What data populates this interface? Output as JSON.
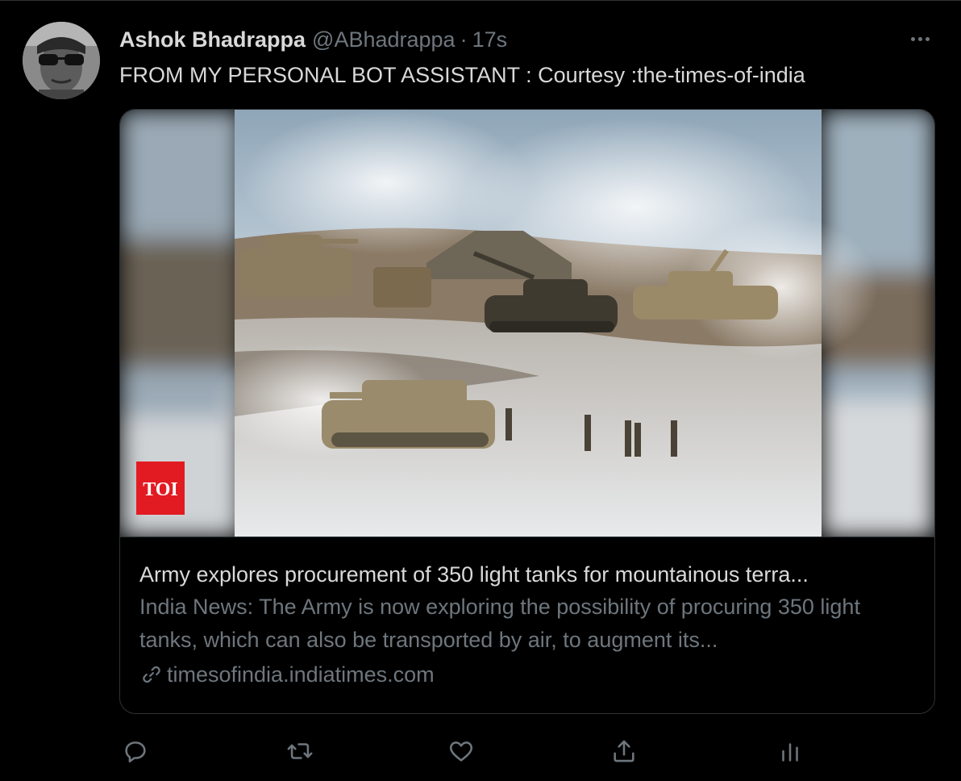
{
  "tweet": {
    "author_name": "Ashok Bhadrappa",
    "author_handle": "@ABhadrappa",
    "separator": "·",
    "timestamp": "17s",
    "text": "FROM MY PERSONAL BOT ASSISTANT : Courtesy :the-times-of-india"
  },
  "card": {
    "brand_logo": "TOI",
    "title": "Army explores procurement of 350 light tanks for mountainous terra...",
    "description": "India News: The Army is now exploring the possibility of procuring 350 light tanks, which can also be transported by air, to augment its...",
    "domain": "timesofindia.indiatimes.com",
    "image_alt": "Tanks and soldiers on a snowy mountainous plateau amid smoke"
  },
  "actions": [
    {
      "name": "reply",
      "icon": "reply-icon"
    },
    {
      "name": "retweet",
      "icon": "retweet-icon"
    },
    {
      "name": "like",
      "icon": "heart-icon"
    },
    {
      "name": "share",
      "icon": "share-icon"
    },
    {
      "name": "analytics",
      "icon": "analytics-icon"
    }
  ],
  "colors": {
    "background": "#000000",
    "text_primary": "#d9d9d9",
    "text_secondary": "#6e767d",
    "border": "#2f3336",
    "toi_red": "#e21b22"
  }
}
